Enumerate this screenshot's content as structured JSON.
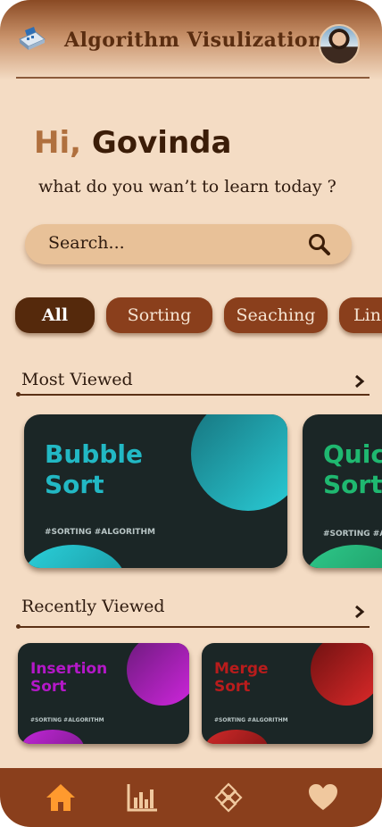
{
  "header": {
    "title": "Algorithm Visulization",
    "logo_icon": "laptop-logo-icon",
    "avatar_icon": "user-avatar"
  },
  "greeting": {
    "hi": "Hi,",
    "name": "Govinda",
    "subtext": "what  do you wan’t to learn today ?"
  },
  "search": {
    "placeholder": "Search...",
    "icon": "search-icon"
  },
  "categories": [
    {
      "label": "All",
      "active": true
    },
    {
      "label": "Sorting",
      "active": false
    },
    {
      "label": "Seaching",
      "active": false
    },
    {
      "label": "Lin",
      "active": false
    }
  ],
  "most_viewed": {
    "title": "Most Viewed",
    "cards": [
      {
        "title_line1": "Bubble",
        "title_line2": "Sort",
        "tags": "#SORTING #ALGORITHM",
        "accent": "#22b8c4"
      },
      {
        "title_line1": "Quic",
        "title_line2": "Sort",
        "tags": "#SORTING #AL",
        "accent": "#1fb870"
      }
    ]
  },
  "recently_viewed": {
    "title": "Recently Viewed",
    "cards": [
      {
        "title_line1": "Insertion",
        "title_line2": "Sort",
        "tags": "#SORTING #ALGORITHM",
        "accent": "#b418c8"
      },
      {
        "title_line1": "Merge",
        "title_line2": "Sort",
        "tags": "#SORTING #ALGORITHM",
        "accent": "#b81c1c"
      }
    ]
  },
  "bottom_nav": [
    {
      "icon": "home-icon",
      "active": true
    },
    {
      "icon": "bar-chart-icon",
      "active": false
    },
    {
      "icon": "ornament-icon",
      "active": false
    },
    {
      "icon": "heart-icon",
      "active": false
    }
  ],
  "colors": {
    "background": "#f4dcc4",
    "brand_dark": "#55290c",
    "chip": "#8a3f1c",
    "nav_active": "#ff9a2e"
  }
}
